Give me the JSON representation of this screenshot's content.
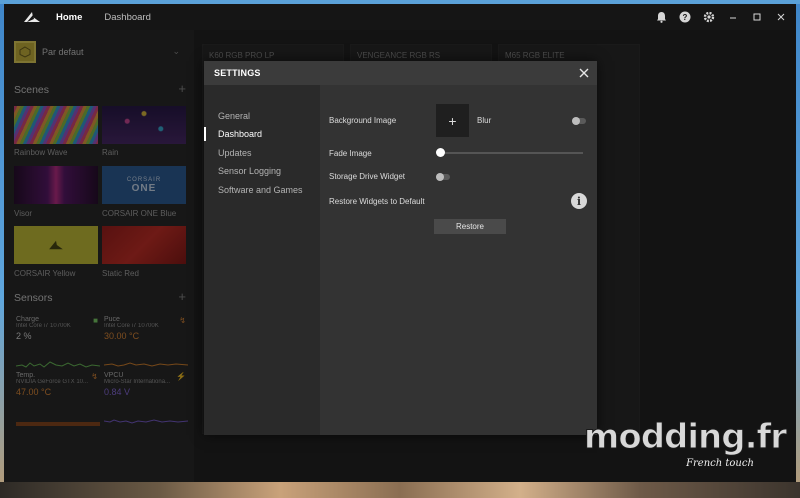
{
  "titlebar": {
    "tabs": [
      {
        "label": "Home",
        "active": true
      },
      {
        "label": "Dashboard",
        "active": false
      }
    ]
  },
  "sidebar": {
    "profile_name": "Par defaut",
    "scenes_title": "Scenes",
    "scenes": [
      {
        "label": "Rainbow Wave",
        "icon": "rainbow-wave-thumb"
      },
      {
        "label": "Rain",
        "icon": "rain-thumb"
      },
      {
        "label": "Visor",
        "icon": "visor-thumb"
      },
      {
        "label": "CORSAIR ONE Blue",
        "icon": "corsair-one-blue-thumb",
        "thumb_text_1": "CORSAIR",
        "thumb_text_2": "ONE"
      },
      {
        "label": "CORSAIR Yellow",
        "icon": "corsair-yellow-thumb"
      },
      {
        "label": "Static Red",
        "icon": "static-red-thumb"
      }
    ],
    "sensors_title": "Sensors",
    "sensors": [
      {
        "name": "Charge",
        "device": "Intel Core i7 10700K",
        "value": "2",
        "unit": "%",
        "color": "#7fd36a"
      },
      {
        "name": "Puce",
        "device": "Intel Core i7 10700K",
        "value": "30.00",
        "unit": "°C",
        "color": "#e28c3a"
      },
      {
        "name": "Temp.",
        "device": "NVIDIA GeForce GTX 10...",
        "value": "47.00",
        "unit": "°C",
        "color": "#e28c3a"
      },
      {
        "name": "VPCU",
        "device": "Micro-Star Internationa...",
        "value": "0.84",
        "unit": "V",
        "color": "#8a6de0"
      }
    ]
  },
  "devices": [
    "K60 RGB PRO LP",
    "VENGEANCE RGB RS",
    "M65 RGB ELITE"
  ],
  "dialog": {
    "title": "SETTINGS",
    "nav": [
      {
        "label": "General",
        "active": false
      },
      {
        "label": "Dashboard",
        "active": true
      },
      {
        "label": "Updates",
        "active": false
      },
      {
        "label": "Sensor Logging",
        "active": false
      },
      {
        "label": "Software and Games",
        "active": false
      }
    ],
    "background_image_label": "Background Image",
    "blur_label": "Blur",
    "fade_image_label": "Fade Image",
    "fade_image_value": 0,
    "storage_widget_label": "Storage Drive Widget",
    "restore_label": "Restore Widgets to Default",
    "restore_button": "Restore"
  },
  "watermark": {
    "text": "modding.fr",
    "tagline": "French touch"
  }
}
